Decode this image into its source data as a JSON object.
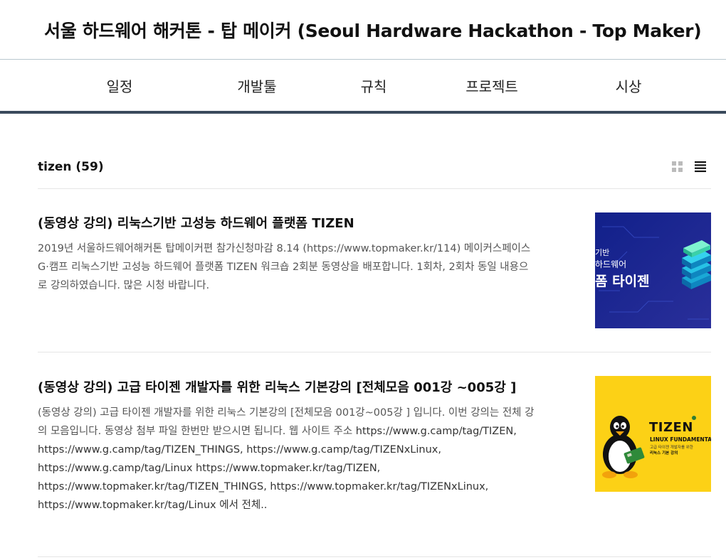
{
  "site": {
    "title": "서울 하드웨어 해커톤 - 탑 메이커 (Seoul Hardware Hackathon - Top Maker)"
  },
  "nav": {
    "items": [
      {
        "label": "일정"
      },
      {
        "label": "개발툴"
      },
      {
        "label": "규칙"
      },
      {
        "label": "프로젝트"
      },
      {
        "label": "시상"
      }
    ]
  },
  "list": {
    "title": "tizen (59)",
    "view_modes": [
      "grid-view-icon",
      "list-view-icon"
    ],
    "active_view": "list"
  },
  "posts": [
    {
      "title": "(동영상 강의) 리눅스기반 고성능 하드웨어 플랫폼 TIZEN",
      "excerpt": "2019년 서울하드웨어해커톤 탑메이커편 참가신청마감 8.14 (https://www.topmaker.kr/114) 메이커스페이스 G·캠프 리눅스기반 고성능 하드웨어 플랫폼 TIZEN 워크숍 2회분 동영상을 배포합니다. 1회차, 2회차 동일 내용으로 강의하였습니다. 많은 시청 바랍니다.",
      "thumbnail": {
        "line1": "기반",
        "line2": "하드웨어",
        "line3": "폼 타이젠",
        "bg": "#1b2a8a"
      }
    },
    {
      "title": "(동영상 강의) 고급 타이젠 개발자를 위한 리눅스 기본강의 [전체모음 001강 ~005강 ]",
      "excerpt_lead": "(동영상 강의) 고급 타이젠 개발자를 위한 리눅스 기본강의 [전체모음 001강~005강 ] 입니다. 이번 강의는 전체 강의 모음입니다. 동영상 첨부 파일 한번만 받으시면 됩니다. 웹 사이트 주소",
      "excerpt_links": "https://www.g.camp/tag/TIZEN, https://www.g.camp/tag/TIZEN_THINGS, https://www.g.camp/tag/TIZENxLinux, https://www.g.camp/tag/Linux https://www.topmaker.kr/tag/TIZEN, https://www.topmaker.kr/tag/TIZEN_THINGS, https://www.topmaker.kr/tag/TIZENxLinux, https://www.topmaker.kr/tag/Linux 에서 전체..",
      "thumbnail": {
        "brand": "TIZEN",
        "subtitle": "LINUX FUNDAMENTALS",
        "caption1": "고급 타이젠 개발자를 위한",
        "caption2": "리눅스 기본 강의",
        "bg": "#fcd116"
      }
    }
  ],
  "colors": {
    "nav_border": "#3a4a5c",
    "thumb1_bg": "#1b2a8a",
    "thumb2_bg": "#fcd116"
  }
}
